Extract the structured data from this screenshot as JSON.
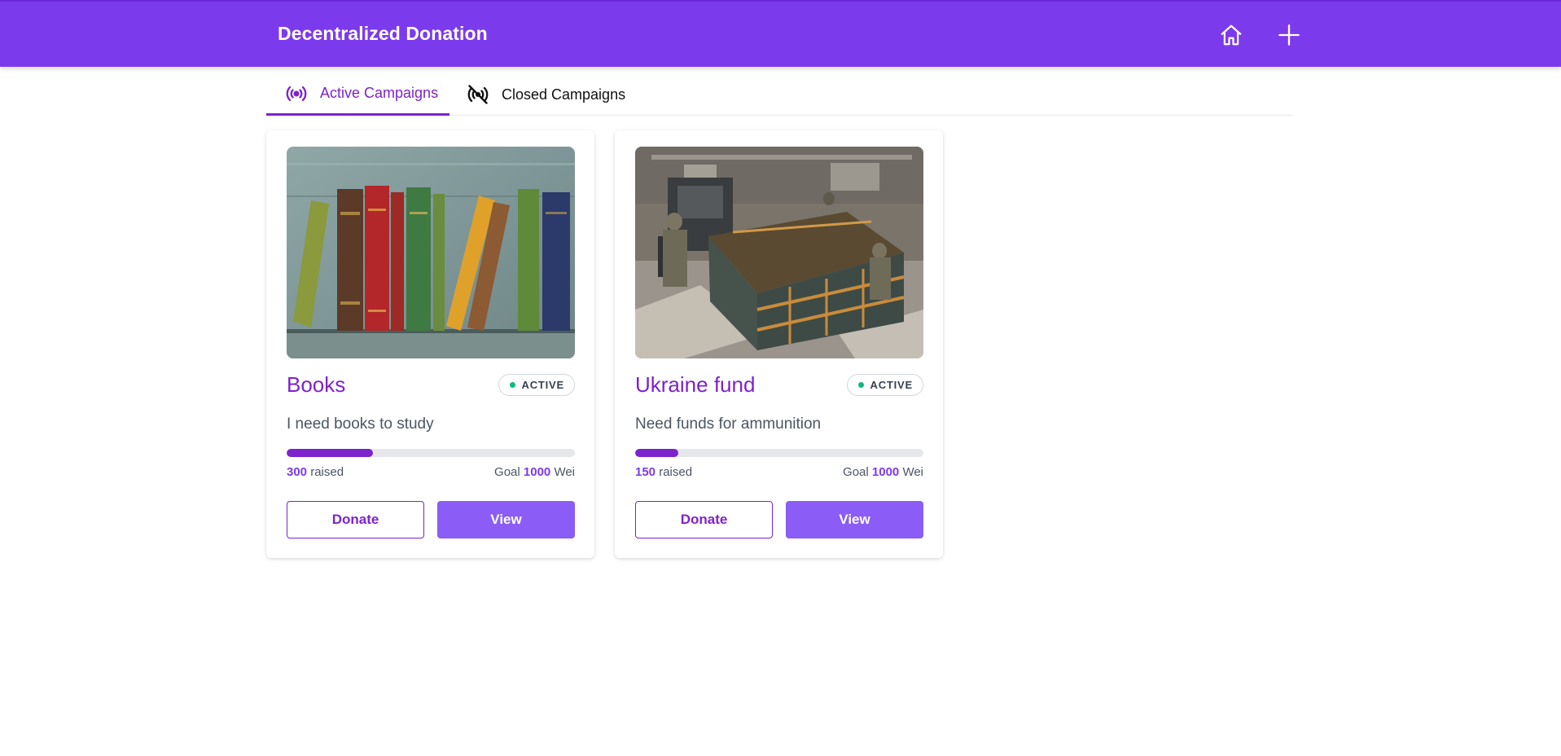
{
  "header": {
    "title": "Decentralized Donation",
    "home_icon": "home-icon",
    "add_icon": "plus-icon"
  },
  "tabs": [
    {
      "label": "Active Campaigns",
      "icon": "broadcast-icon",
      "active": true
    },
    {
      "label": "Closed Campaigns",
      "icon": "broadcast-off-icon",
      "active": false
    }
  ],
  "campaigns": [
    {
      "title": "Books",
      "status": "ACTIVE",
      "description": "I need books to study",
      "raised": "300",
      "raised_label": "raised",
      "goal_label": "Goal",
      "goal": "1000",
      "unit": "Wei",
      "progress_fraction": 0.3,
      "donate_label": "Donate",
      "view_label": "View"
    },
    {
      "title": "Ukraine fund",
      "status": "ACTIVE",
      "description": "Need funds for ammunition",
      "raised": "150",
      "raised_label": "raised",
      "goal_label": "Goal",
      "goal": "1000",
      "unit": "Wei",
      "progress_fraction": 0.15,
      "donate_label": "Donate",
      "view_label": "View"
    }
  ],
  "colors": {
    "brand": "#7c3aed",
    "accent": "#7e22ce",
    "button": "#8b5cf6",
    "status_active": "#10b981"
  }
}
